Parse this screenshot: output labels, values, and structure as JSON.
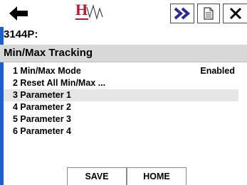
{
  "toolbar": {
    "back_icon": "back-arrow-icon",
    "logo_icon": "hart-logo-icon",
    "logo_text": "H",
    "forward_icon": "double-chevron-right-icon",
    "document_icon": "document-icon",
    "close_icon": "close-icon"
  },
  "device": {
    "tag": "3144P:"
  },
  "screen": {
    "title": "Min/Max Tracking"
  },
  "menu": {
    "items": [
      {
        "label": "1 Min/Max Mode",
        "value": "Enabled",
        "selected": false
      },
      {
        "label": "2 Reset All Min/Max ...",
        "value": "",
        "selected": false
      },
      {
        "label": "3 Parameter 1",
        "value": "",
        "selected": true
      },
      {
        "label": "4 Parameter 2",
        "value": "",
        "selected": false
      },
      {
        "label": "5 Parameter 3",
        "value": "",
        "selected": false
      },
      {
        "label": "6 Parameter 4",
        "value": "",
        "selected": false
      }
    ]
  },
  "softkeys": {
    "save_label": "SAVE",
    "home_label": "HOME"
  },
  "colors": {
    "accent_blue": "#1a5fd6",
    "forward_arrow": "#2a2a9e",
    "logo_red": "#c8102e",
    "selected_row": "#e6e6e6",
    "title_bar": "#d8d8d8"
  }
}
